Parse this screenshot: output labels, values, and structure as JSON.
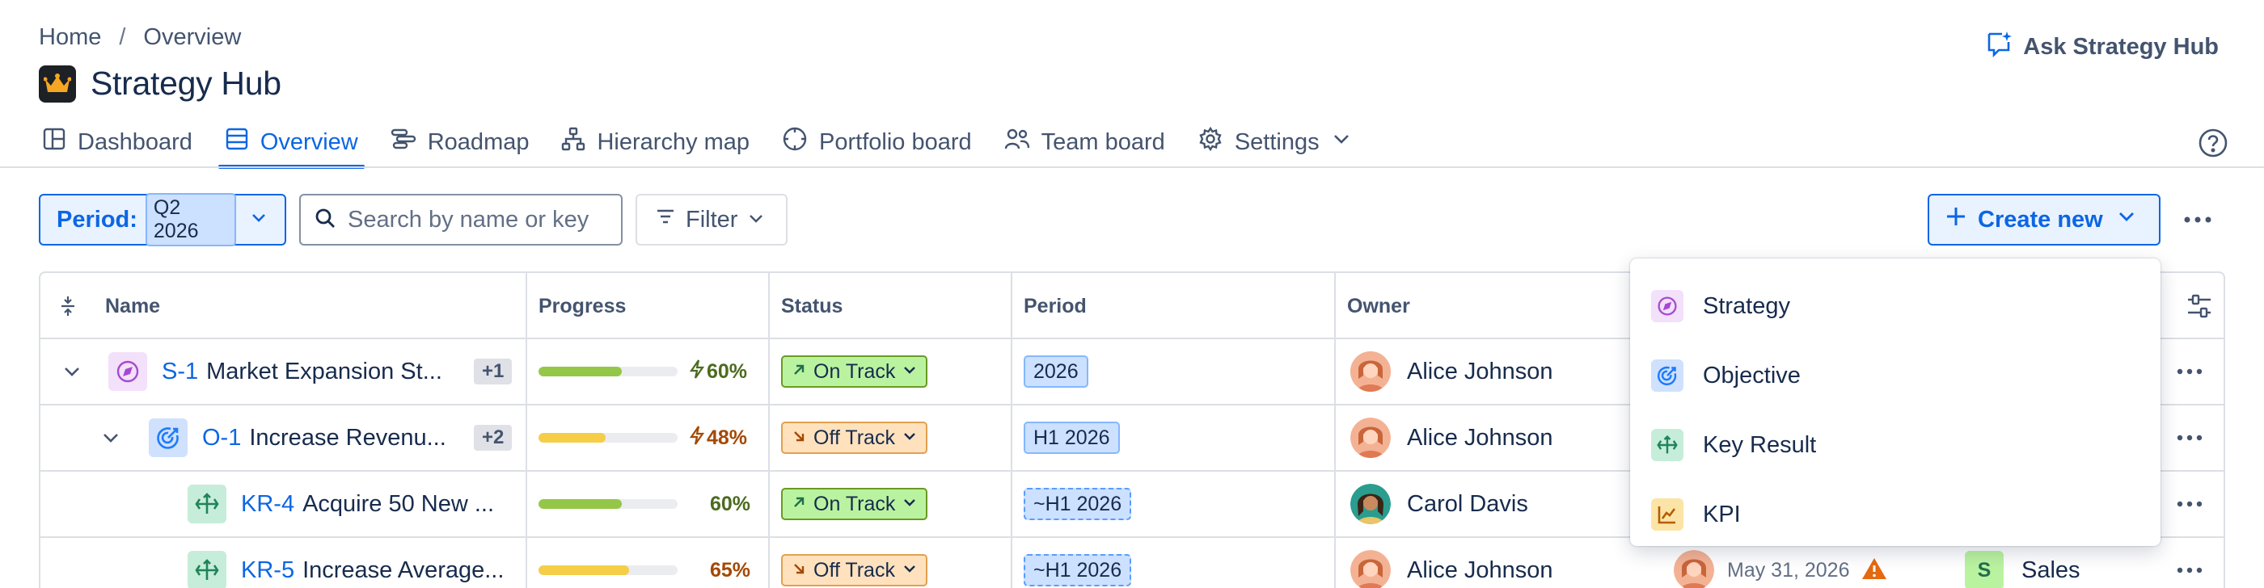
{
  "breadcrumb": {
    "home": "Home",
    "separator": "/",
    "current": "Overview"
  },
  "app": {
    "title": "Strategy Hub"
  },
  "header": {
    "ask_label": "Ask Strategy Hub"
  },
  "tabs": [
    {
      "label": "Dashboard",
      "icon": "dashboard-icon"
    },
    {
      "label": "Overview",
      "icon": "list-icon",
      "active": true
    },
    {
      "label": "Roadmap",
      "icon": "roadmap-icon"
    },
    {
      "label": "Hierarchy map",
      "icon": "hierarchy-icon"
    },
    {
      "label": "Portfolio board",
      "icon": "portfolio-icon"
    },
    {
      "label": "Team board",
      "icon": "team-icon"
    },
    {
      "label": "Settings",
      "icon": "gear-icon"
    }
  ],
  "toolbar": {
    "period_label": "Period:",
    "period_value": "Q2 2026",
    "search_placeholder": "Search by name or key",
    "filter_label": "Filter",
    "create_label": "Create new"
  },
  "table": {
    "columns": [
      "Name",
      "Progress",
      "Status",
      "Period",
      "Owner"
    ],
    "rows": [
      {
        "key": "S-1",
        "name": "Market Expansion St...",
        "more": "+1",
        "type": "strategy",
        "progress": 60,
        "progress_label": "60%",
        "bolt": true,
        "status": "On Track",
        "period": "2026",
        "period_dashed": false,
        "owner": "Alice Johnson"
      },
      {
        "key": "O-1",
        "name": "Increase Revenu...",
        "more": "+2",
        "type": "objective",
        "progress": 48,
        "progress_label": "48%",
        "bolt": true,
        "status": "Off Track",
        "period": "H1 2026",
        "period_dashed": false,
        "owner": "Alice Johnson"
      },
      {
        "key": "KR-4",
        "name": "Acquire 50 New ...",
        "more": "",
        "type": "key-result",
        "progress": 60,
        "progress_label": "60%",
        "bolt": false,
        "status": "On Track",
        "period": "~H1 2026",
        "period_dashed": true,
        "owner": "Carol Davis"
      },
      {
        "key": "KR-5",
        "name": "Increase Average...",
        "more": "",
        "type": "key-result",
        "progress": 65,
        "progress_label": "65%",
        "bolt": false,
        "status": "Off Track",
        "period": "~H1 2026",
        "period_dashed": true,
        "owner": "Alice Johnson",
        "due_date": "May 31, 2026",
        "team_initial": "S",
        "team": "Sales"
      }
    ]
  },
  "create_menu": {
    "items": [
      {
        "label": "Strategy",
        "icon": "compass-icon"
      },
      {
        "label": "Objective",
        "icon": "target-icon"
      },
      {
        "label": "Key Result",
        "icon": "key-result-icon"
      },
      {
        "label": "KPI",
        "icon": "kpi-chart-icon"
      }
    ]
  },
  "colors": {
    "accent": "#0c66e4",
    "on_track": "#baf3a0",
    "off_track": "#ffe2bd",
    "bar_green": "#94c748",
    "bar_yellow": "#f5cd47"
  }
}
